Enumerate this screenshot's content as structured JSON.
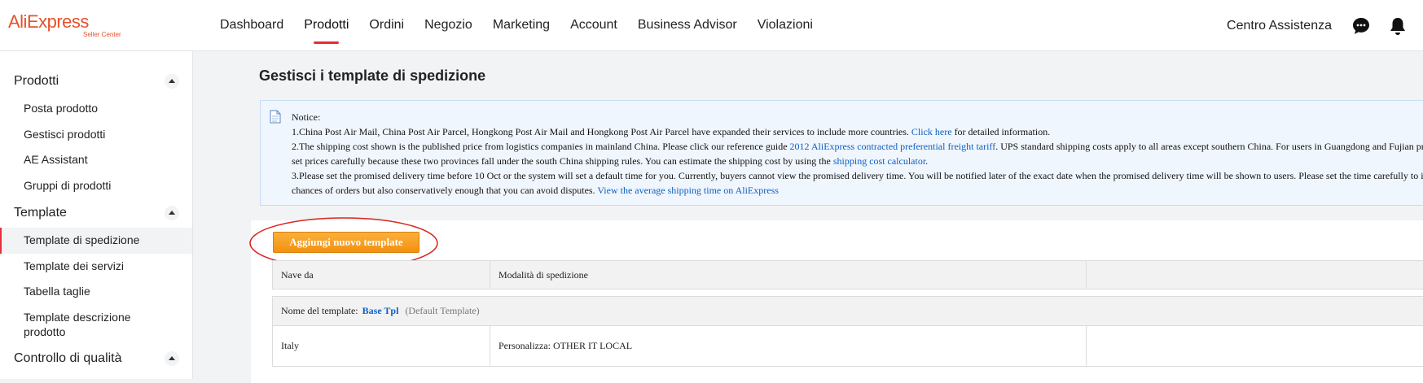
{
  "header": {
    "brand": "AliExpress",
    "brand_sub": "Seller Center",
    "nav": [
      "Dashboard",
      "Prodotti",
      "Ordini",
      "Negozio",
      "Marketing",
      "Account",
      "Business Advisor",
      "Violazioni"
    ],
    "active_nav": "Prodotti",
    "help_label": "Centro Assistenza",
    "icons": [
      "chat-icon",
      "bell-icon"
    ],
    "accent_color": "#e62e3a"
  },
  "sidebar": {
    "groups": [
      {
        "label": "Prodotti",
        "items": [
          "Posta prodotto",
          "Gestisci prodotti",
          "AE Assistant",
          "Gruppi di prodotti"
        ]
      },
      {
        "label": "Template",
        "items": [
          "Template di spedizione",
          "Template dei servizi",
          "Tabella taglie",
          "Template descrizione prodotto"
        ]
      },
      {
        "label": "Controllo di qualità",
        "items": []
      }
    ],
    "active_item": "Template di spedizione"
  },
  "main": {
    "title": "Gestisci i template di spedizione",
    "notice": {
      "heading": "Notice:",
      "line1_text": "1.China Post Air Mail, China Post Air Parcel, Hongkong Post Air Mail and Hongkong Post Air Parcel have expanded their services to include more countries. ",
      "line1_link": "Click here",
      "line1_after": " for detailed information.",
      "line2_text": "2.The shipping cost shown is the published price from logistics companies in mainland China. Please click our reference guide ",
      "line2_link": "2012 AliExpress contracted preferential freight tariff",
      "line2_after": ". UPS standard shipping costs apply to all areas except southern China. For users in Guangdong and Fujian pr",
      "line3_text": "set prices carefully because these two provinces fall under the south China shipping rules. You can estimate the shipping cost by using the ",
      "line3_link": "shipping cost calculator",
      "line3_after": ".",
      "line4_text": "3.Please set the promised delivery time before 10 Oct or the system will set a default time for you. Currently, buyers cannot view the promised delivery time. You will be notified later of the exact date when the promised delivery time will be shown to users. Please set the time carefully to i",
      "line5_text": "chances of orders but also conservatively enough that you can avoid disputes. ",
      "line5_link": "View the average shipping time on AliExpress"
    },
    "add_button_label": "Aggiungi nuovo template",
    "table": {
      "columns": [
        "Nave da",
        "Modalità di spedizione",
        ""
      ],
      "template_label": "Nome del template:",
      "template_name": "Base Tpl",
      "template_tag": "(Default Template)",
      "rows": [
        {
          "from": "Italy",
          "mode": "Personalizza: OTHER IT LOCAL",
          "extra": ""
        }
      ]
    },
    "button_color": "#f29111",
    "link_color": "#0d5fc4"
  }
}
